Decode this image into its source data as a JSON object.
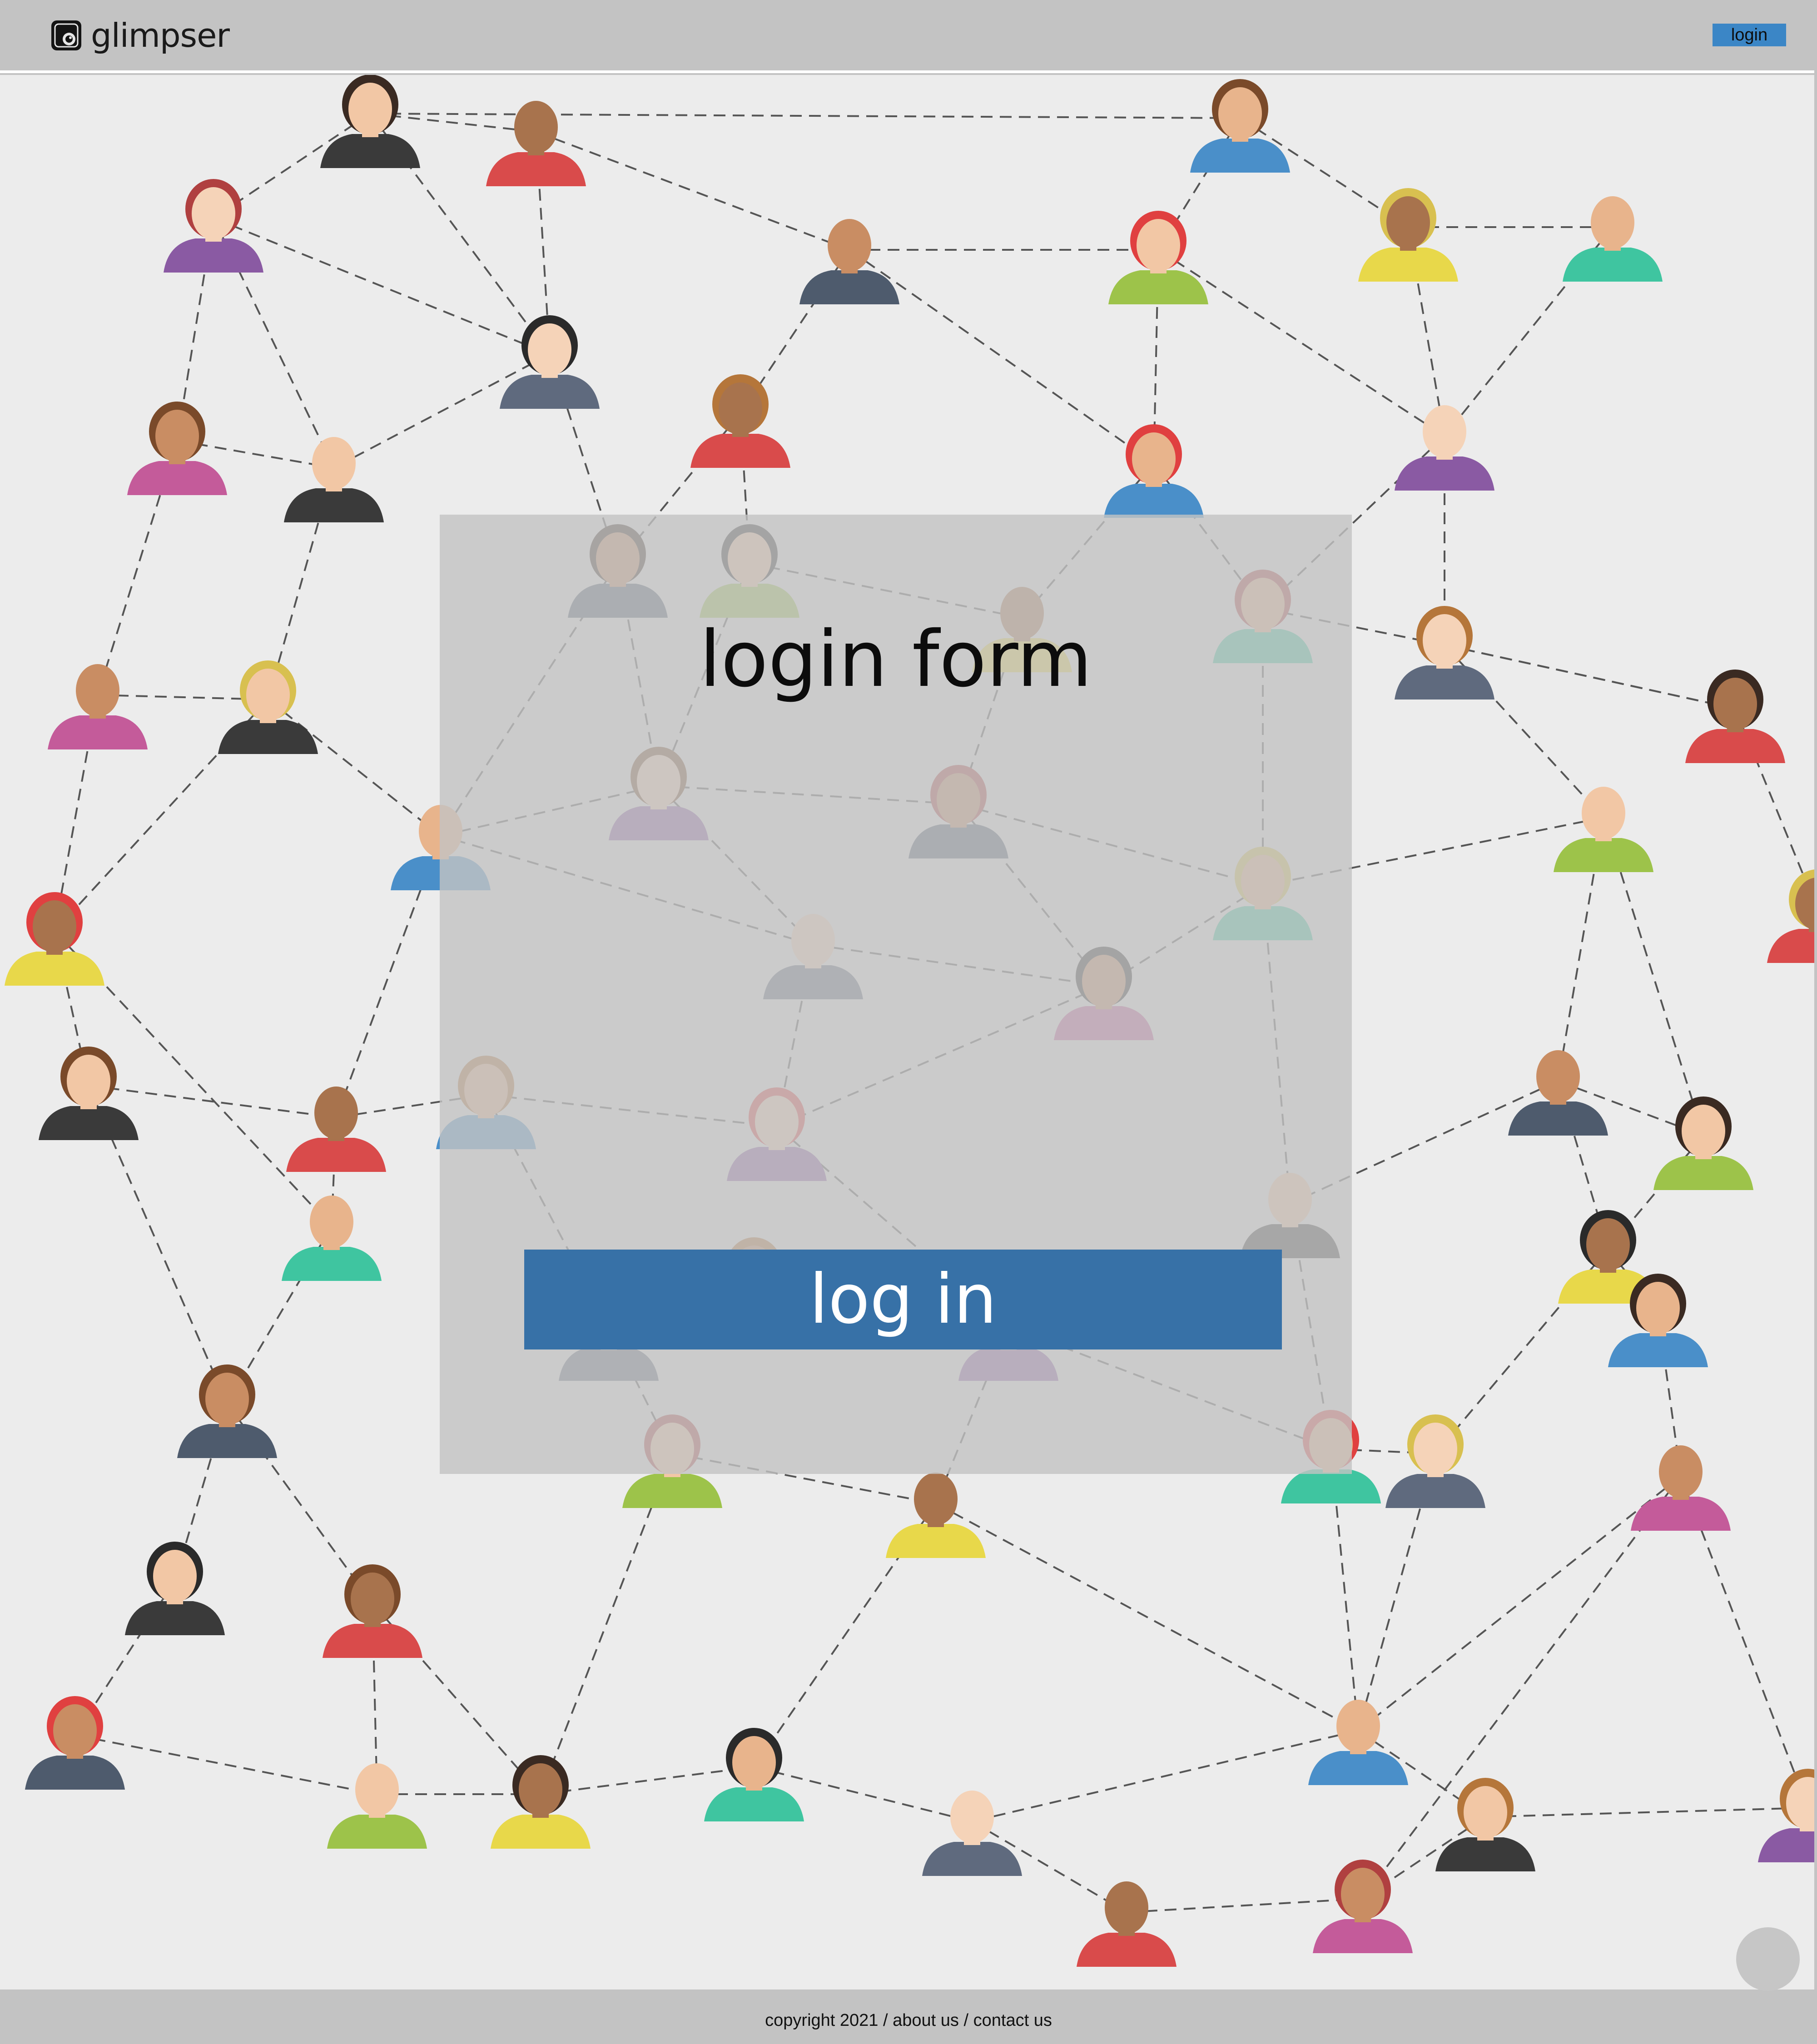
{
  "header": {
    "brand_name": "glimpser",
    "brand_icon": "camera-lens-icon",
    "login_label": "login"
  },
  "login_form": {
    "title": "login form",
    "submit_label": "log in"
  },
  "footer": {
    "copyright": "copyright 2021",
    "separator": " / ",
    "about": "about us",
    "contact": "contact us"
  },
  "colors": {
    "header_bg": "#c3c3c3",
    "stage_bg": "#ececec",
    "primary_button": "#3771a7",
    "nav_button": "#3b86c6"
  },
  "background_icon": "social-network-people-icon",
  "chat_icon": "chat-bubble-icon"
}
